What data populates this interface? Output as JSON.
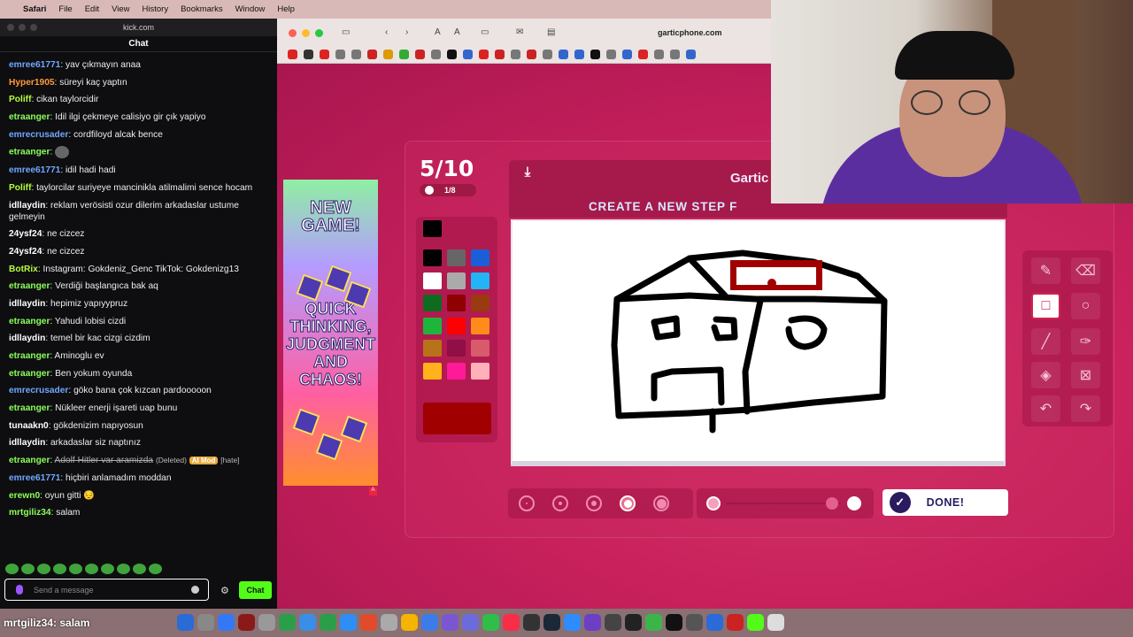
{
  "menubar": {
    "app": "Safari",
    "items": [
      "File",
      "Edit",
      "View",
      "History",
      "Bookmarks",
      "Window",
      "Help"
    ]
  },
  "chat": {
    "site": "kick.com",
    "title": "Chat",
    "messages": [
      {
        "user": "emree61771",
        "color": "#6fa8ff",
        "text": "yav çıkmayın anaa"
      },
      {
        "user": "Hyper1905",
        "color": "#ff9a3c",
        "text": "süreyi kaç yaptın"
      },
      {
        "user": "Poliff",
        "color": "#b6ff3c",
        "text": "cikan taylorcidir"
      },
      {
        "user": "etraanger",
        "color": "#8cff5a",
        "text": "Idil ilgi çekmeye calisiyo gir çık yapiyo"
      },
      {
        "user": "emrecrusader",
        "color": "#6fa8ff",
        "text": "cordfiloyd alcak bence"
      },
      {
        "user": "etraanger",
        "color": "#8cff5a",
        "text": "",
        "emote": true
      },
      {
        "user": "emree61771",
        "color": "#6fa8ff",
        "text": "idil hadi hadi"
      },
      {
        "user": "Poliff",
        "color": "#b6ff3c",
        "text": "taylorcilar suriyeye mancinikla atilmalimi sence hocam"
      },
      {
        "user": "idllaydin",
        "color": "#ffffff",
        "text": "reklam verösisti ozur dilerim arkadaslar ustume gelmeyin"
      },
      {
        "user": "24ysf24",
        "color": "#ffffff",
        "text": "ne cizcez"
      },
      {
        "user": "24ysf24",
        "color": "#ffffff",
        "text": "ne cizcez"
      },
      {
        "user": "BotRix",
        "color": "#b6ff3c",
        "text": "Instagram: Gokdeniz_Genc TikTok: Gokdenizg13"
      },
      {
        "user": "etraanger",
        "color": "#8cff5a",
        "text": "Verdiği başlangıca bak aq"
      },
      {
        "user": "idllaydin",
        "color": "#ffffff",
        "text": "hepimiz yapıyypruz"
      },
      {
        "user": "etraanger",
        "color": "#8cff5a",
        "text": "Yahudi lobisi cizdi"
      },
      {
        "user": "idllaydin",
        "color": "#ffffff",
        "text": "temel bir kac cizgi cizdim"
      },
      {
        "user": "etraanger",
        "color": "#8cff5a",
        "text": "Aminoglu ev"
      },
      {
        "user": "etraanger",
        "color": "#8cff5a",
        "text": "Ben yokum oyunda"
      },
      {
        "user": "emrecrusader",
        "color": "#6fa8ff",
        "text": "göko bana çok kızcan pardooooon"
      },
      {
        "user": "etraanger",
        "color": "#8cff5a",
        "text": "Nükleer enerji işareti uap bunu"
      },
      {
        "user": "tunaakn0",
        "color": "#ffffff",
        "text": "gökdenizim napıyosun"
      },
      {
        "user": "idllaydin",
        "color": "#ffffff",
        "text": "arkadaslar siz naptınız"
      },
      {
        "user": "etraanger",
        "color": "#8cff5a",
        "text": "Adolf Hitler var aramizda",
        "deleted": true,
        "tag1": "(Deleted)",
        "tag2": "AI Mod",
        "tag3": "[hate]"
      },
      {
        "user": "emree61771",
        "color": "#6fa8ff",
        "text": "hiçbiri anlamadım moddan"
      },
      {
        "user": "erewn0",
        "color": "#8cff5a",
        "text": "oyun gitti 😔"
      },
      {
        "user": "mrtgiliz34",
        "color": "#8cff5a",
        "text": "salam"
      }
    ],
    "input_placeholder": "Send a message",
    "send_label": "Chat"
  },
  "safari": {
    "url": "garticphone.com"
  },
  "ad": {
    "line1": "NEW GAME!",
    "line2": "QUICK THINKING, JUDGMENT AND CHAOS!"
  },
  "game": {
    "round": "5/10",
    "players": "1/8",
    "logo": "Gartic",
    "heading": "CREATE A NEW STEP F",
    "done_label": "DONE!",
    "palette": [
      "#000000",
      "#666666",
      "#1a5fd8",
      "#ffffff",
      "#aaaaaa",
      "#22b4f5",
      "#0f6b20",
      "#8f0000",
      "#9a3a10",
      "#1fb53b",
      "#ff0000",
      "#ff8c1a",
      "#b87319",
      "#8f0f46",
      "#d75b6b",
      "#ffb21a",
      "#ff1a9a",
      "#ffb0b8"
    ],
    "current_color": "#a10000",
    "selected_brush_size_index": 3,
    "selected_tool": "rectangle"
  },
  "dock": {
    "username": "mrtgiliz34",
    "text": ": salam"
  }
}
